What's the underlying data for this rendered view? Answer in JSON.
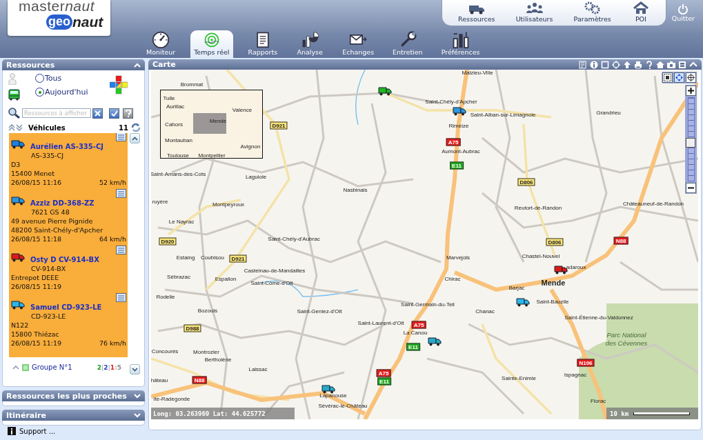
{
  "logo": {
    "top": "master",
    "top_italic": "naut",
    "badge": "geo",
    "bottom": "naut"
  },
  "top_menu": [
    {
      "label": "Ressources"
    },
    {
      "label": "Utilisateurs"
    },
    {
      "label": "Paramètres"
    },
    {
      "label": "POI"
    }
  ],
  "quit": {
    "label": "Quitter"
  },
  "tabs": [
    {
      "label": "Moniteur",
      "selected": false
    },
    {
      "label": "Temps réel",
      "selected": true
    },
    {
      "label": "Rapports",
      "selected": false
    },
    {
      "label": "Analyse",
      "selected": false
    },
    {
      "label": "Echanges",
      "selected": false
    },
    {
      "label": "Entretien",
      "selected": false
    },
    {
      "label": "Préférences",
      "selected": false
    }
  ],
  "resources": {
    "title": "Ressources",
    "filters": [
      {
        "label": "Tous",
        "selected": false
      },
      {
        "label": "Aujourd'hui",
        "selected": true
      }
    ],
    "search": {
      "placeholder": "Ressources à afficher"
    },
    "category": "Véhicules",
    "count": "11",
    "vehicles": [
      {
        "name": "Aurélien AS-335-CJ",
        "plate": "AS-335-CJ",
        "lines": [
          "D3",
          "15400 Menet"
        ],
        "time": "26/08/15 11:16",
        "speed": "52 km/h",
        "color": "#1f7fe0"
      },
      {
        "name": "Azziz DD-368-ZZ",
        "plate": "7621 GS 48",
        "lines": [
          "49 avenue Pierre Pignide",
          "48200 Saint-Chély-d'Apcher"
        ],
        "time": "26/08/15 11:18",
        "speed": "64 km/h",
        "color": "#2f95de"
      },
      {
        "name": "Osty D CV-914-BX",
        "plate": "CV-914-BX",
        "lines": [
          "Entrepot DEEE"
        ],
        "time": "26/08/15 11:19",
        "color": "#e01818"
      },
      {
        "name": "Samuel CD-923-LE",
        "plate": "CD-923-LE",
        "lines": [
          "N122",
          "15800 Thiézac"
        ],
        "time": "26/08/15 11:19",
        "speed": "76 km/h",
        "color": "#2fb6e6"
      }
    ],
    "group": {
      "label": "Groupe N°1",
      "counts": [
        {
          "value": "2",
          "color": "#1c9a1c"
        },
        {
          "value": "2",
          "color": "#2040d0"
        },
        {
          "value": "1",
          "color": "#e02020"
        },
        {
          "value": "5",
          "color": "#8a8a8a"
        }
      ],
      "separators": [
        "|",
        "|",
        ":"
      ]
    }
  },
  "panels": [
    {
      "title": "Ressources les plus proches",
      "expanded": false
    },
    {
      "title": "Itinéraire",
      "expanded": false
    }
  ],
  "support": "Support ...",
  "map": {
    "title": "Carte",
    "overview_places": [
      "Tulle",
      "Aurillac",
      "Valence",
      "Cahors",
      "Mende",
      "Montauban",
      "Avignon",
      "Toulouse",
      "Montpellier"
    ],
    "places": [
      {
        "name": "Malzieu-Ville",
        "kind": "town"
      },
      {
        "name": "Brommat",
        "kind": "town"
      },
      {
        "name": "Saint-Chély-d'Apcher",
        "kind": "town"
      },
      {
        "name": "Saint-Alban-sur-Limagnole",
        "kind": "town"
      },
      {
        "name": "Grandrieu",
        "kind": "town"
      },
      {
        "name": "Rimeize",
        "kind": "town"
      },
      {
        "name": "Aumont-Aubrac",
        "kind": "town"
      },
      {
        "name": "Saint-Amans-des-Cots",
        "kind": "town"
      },
      {
        "name": "Laguiole",
        "kind": "town"
      },
      {
        "name": "Nasbinals",
        "kind": "town"
      },
      {
        "name": "ruyère",
        "kind": "town"
      },
      {
        "name": "Montpeyroux",
        "kind": "town"
      },
      {
        "name": "Reutort-de-Randon",
        "kind": "town"
      },
      {
        "name": "Châteauneuf-de-Randon",
        "kind": "town"
      },
      {
        "name": "Le Nayrac",
        "kind": "town"
      },
      {
        "name": "Saint-Chély-d'Aubrac",
        "kind": "town"
      },
      {
        "name": "Chastel-Nouvel",
        "kind": "town"
      },
      {
        "name": "Estaing",
        "kind": "town"
      },
      {
        "name": "Coubisou",
        "kind": "town"
      },
      {
        "name": "Marvejols",
        "kind": "town"
      },
      {
        "name": "adaroux",
        "kind": "town"
      },
      {
        "name": "Castelnau-de-Mandailles",
        "kind": "town"
      },
      {
        "name": "Sébrazac",
        "kind": "town"
      },
      {
        "name": "Espalion",
        "kind": "town"
      },
      {
        "name": "Saint-Côme-d'Olt",
        "kind": "town"
      },
      {
        "name": "Chirac",
        "kind": "town"
      },
      {
        "name": "Mende",
        "kind": "city"
      },
      {
        "name": "Barjac",
        "kind": "town"
      },
      {
        "name": "Rodelle",
        "kind": "town"
      },
      {
        "name": "Saint-Bauzile",
        "kind": "town"
      },
      {
        "name": "Saint-Germain-du-Teil",
        "kind": "town"
      },
      {
        "name": "Bozouls",
        "kind": "town"
      },
      {
        "name": "Saint-Geniez-d'Olt",
        "kind": "town"
      },
      {
        "name": "Chanac",
        "kind": "town"
      },
      {
        "name": "Saint-Étienne-du-Valdonnez",
        "kind": "town"
      },
      {
        "name": "Saint-Laurent-d'Olt",
        "kind": "town"
      },
      {
        "name": "La Canou",
        "kind": "town"
      },
      {
        "name": "Parc National",
        "kind": "park"
      },
      {
        "name": "des Cévennes",
        "kind": "park"
      },
      {
        "name": "Concourès",
        "kind": "town"
      },
      {
        "name": "Montrozier",
        "kind": "town"
      },
      {
        "name": "Bertholène",
        "kind": "town"
      },
      {
        "name": "Laissac",
        "kind": "town"
      },
      {
        "name": "Ispagnac",
        "kind": "town"
      },
      {
        "name": "Sainte-Enimie",
        "kind": "town"
      },
      {
        "name": "hâteau",
        "kind": "town"
      },
      {
        "name": "Lapanouse",
        "kind": "town"
      },
      {
        "name": "ite-Radegonde",
        "kind": "town"
      },
      {
        "name": "Florac",
        "kind": "town"
      },
      {
        "name": "Sévérac-le-Château",
        "kind": "town"
      }
    ],
    "roads": [
      {
        "label": "D921",
        "kind": "departmental"
      },
      {
        "label": "A75",
        "kind": "motorway"
      },
      {
        "label": "E11",
        "kind": "european"
      },
      {
        "label": "D806",
        "kind": "departmental"
      },
      {
        "label": "D920",
        "kind": "departmental"
      },
      {
        "label": "D921",
        "kind": "departmental"
      },
      {
        "label": "D806",
        "kind": "departmental"
      },
      {
        "label": "N88",
        "kind": "national"
      },
      {
        "label": "A75",
        "kind": "motorway"
      },
      {
        "label": "D988",
        "kind": "departmental"
      },
      {
        "label": "E11",
        "kind": "european"
      },
      {
        "label": "N106",
        "kind": "national"
      },
      {
        "label": "A75",
        "kind": "motorway"
      },
      {
        "label": "N88",
        "kind": "national"
      },
      {
        "label": "E11",
        "kind": "european"
      }
    ],
    "vehicles": [
      {
        "color": "#22b422"
      },
      {
        "color": "#2f95de"
      },
      {
        "color": "#e01818"
      },
      {
        "color": "#2fb6e6"
      },
      {
        "color": "#2aa8c8"
      },
      {
        "color": "#2aa8c8"
      }
    ],
    "zoom": {
      "level": 0.45
    },
    "coordinates": "Long: 03.263969 Lat: 44.625772",
    "scale": "10 km"
  }
}
